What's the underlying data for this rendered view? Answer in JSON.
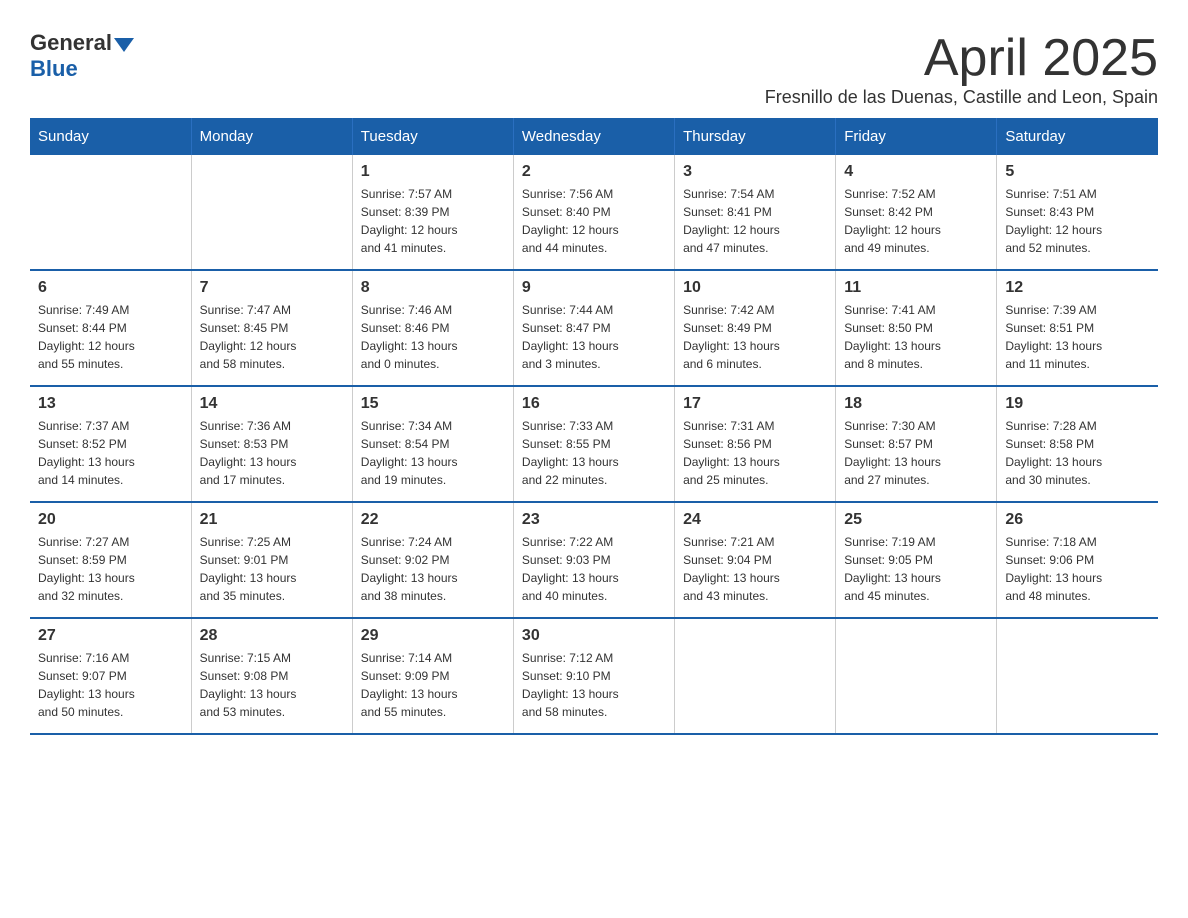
{
  "logo": {
    "general": "General",
    "blue": "Blue"
  },
  "header": {
    "month_year": "April 2025",
    "location": "Fresnillo de las Duenas, Castille and Leon, Spain"
  },
  "days_of_week": [
    "Sunday",
    "Monday",
    "Tuesday",
    "Wednesday",
    "Thursday",
    "Friday",
    "Saturday"
  ],
  "weeks": [
    [
      {
        "day": "",
        "info": ""
      },
      {
        "day": "",
        "info": ""
      },
      {
        "day": "1",
        "info": "Sunrise: 7:57 AM\nSunset: 8:39 PM\nDaylight: 12 hours\nand 41 minutes."
      },
      {
        "day": "2",
        "info": "Sunrise: 7:56 AM\nSunset: 8:40 PM\nDaylight: 12 hours\nand 44 minutes."
      },
      {
        "day": "3",
        "info": "Sunrise: 7:54 AM\nSunset: 8:41 PM\nDaylight: 12 hours\nand 47 minutes."
      },
      {
        "day": "4",
        "info": "Sunrise: 7:52 AM\nSunset: 8:42 PM\nDaylight: 12 hours\nand 49 minutes."
      },
      {
        "day": "5",
        "info": "Sunrise: 7:51 AM\nSunset: 8:43 PM\nDaylight: 12 hours\nand 52 minutes."
      }
    ],
    [
      {
        "day": "6",
        "info": "Sunrise: 7:49 AM\nSunset: 8:44 PM\nDaylight: 12 hours\nand 55 minutes."
      },
      {
        "day": "7",
        "info": "Sunrise: 7:47 AM\nSunset: 8:45 PM\nDaylight: 12 hours\nand 58 minutes."
      },
      {
        "day": "8",
        "info": "Sunrise: 7:46 AM\nSunset: 8:46 PM\nDaylight: 13 hours\nand 0 minutes."
      },
      {
        "day": "9",
        "info": "Sunrise: 7:44 AM\nSunset: 8:47 PM\nDaylight: 13 hours\nand 3 minutes."
      },
      {
        "day": "10",
        "info": "Sunrise: 7:42 AM\nSunset: 8:49 PM\nDaylight: 13 hours\nand 6 minutes."
      },
      {
        "day": "11",
        "info": "Sunrise: 7:41 AM\nSunset: 8:50 PM\nDaylight: 13 hours\nand 8 minutes."
      },
      {
        "day": "12",
        "info": "Sunrise: 7:39 AM\nSunset: 8:51 PM\nDaylight: 13 hours\nand 11 minutes."
      }
    ],
    [
      {
        "day": "13",
        "info": "Sunrise: 7:37 AM\nSunset: 8:52 PM\nDaylight: 13 hours\nand 14 minutes."
      },
      {
        "day": "14",
        "info": "Sunrise: 7:36 AM\nSunset: 8:53 PM\nDaylight: 13 hours\nand 17 minutes."
      },
      {
        "day": "15",
        "info": "Sunrise: 7:34 AM\nSunset: 8:54 PM\nDaylight: 13 hours\nand 19 minutes."
      },
      {
        "day": "16",
        "info": "Sunrise: 7:33 AM\nSunset: 8:55 PM\nDaylight: 13 hours\nand 22 minutes."
      },
      {
        "day": "17",
        "info": "Sunrise: 7:31 AM\nSunset: 8:56 PM\nDaylight: 13 hours\nand 25 minutes."
      },
      {
        "day": "18",
        "info": "Sunrise: 7:30 AM\nSunset: 8:57 PM\nDaylight: 13 hours\nand 27 minutes."
      },
      {
        "day": "19",
        "info": "Sunrise: 7:28 AM\nSunset: 8:58 PM\nDaylight: 13 hours\nand 30 minutes."
      }
    ],
    [
      {
        "day": "20",
        "info": "Sunrise: 7:27 AM\nSunset: 8:59 PM\nDaylight: 13 hours\nand 32 minutes."
      },
      {
        "day": "21",
        "info": "Sunrise: 7:25 AM\nSunset: 9:01 PM\nDaylight: 13 hours\nand 35 minutes."
      },
      {
        "day": "22",
        "info": "Sunrise: 7:24 AM\nSunset: 9:02 PM\nDaylight: 13 hours\nand 38 minutes."
      },
      {
        "day": "23",
        "info": "Sunrise: 7:22 AM\nSunset: 9:03 PM\nDaylight: 13 hours\nand 40 minutes."
      },
      {
        "day": "24",
        "info": "Sunrise: 7:21 AM\nSunset: 9:04 PM\nDaylight: 13 hours\nand 43 minutes."
      },
      {
        "day": "25",
        "info": "Sunrise: 7:19 AM\nSunset: 9:05 PM\nDaylight: 13 hours\nand 45 minutes."
      },
      {
        "day": "26",
        "info": "Sunrise: 7:18 AM\nSunset: 9:06 PM\nDaylight: 13 hours\nand 48 minutes."
      }
    ],
    [
      {
        "day": "27",
        "info": "Sunrise: 7:16 AM\nSunset: 9:07 PM\nDaylight: 13 hours\nand 50 minutes."
      },
      {
        "day": "28",
        "info": "Sunrise: 7:15 AM\nSunset: 9:08 PM\nDaylight: 13 hours\nand 53 minutes."
      },
      {
        "day": "29",
        "info": "Sunrise: 7:14 AM\nSunset: 9:09 PM\nDaylight: 13 hours\nand 55 minutes."
      },
      {
        "day": "30",
        "info": "Sunrise: 7:12 AM\nSunset: 9:10 PM\nDaylight: 13 hours\nand 58 minutes."
      },
      {
        "day": "",
        "info": ""
      },
      {
        "day": "",
        "info": ""
      },
      {
        "day": "",
        "info": ""
      }
    ]
  ]
}
